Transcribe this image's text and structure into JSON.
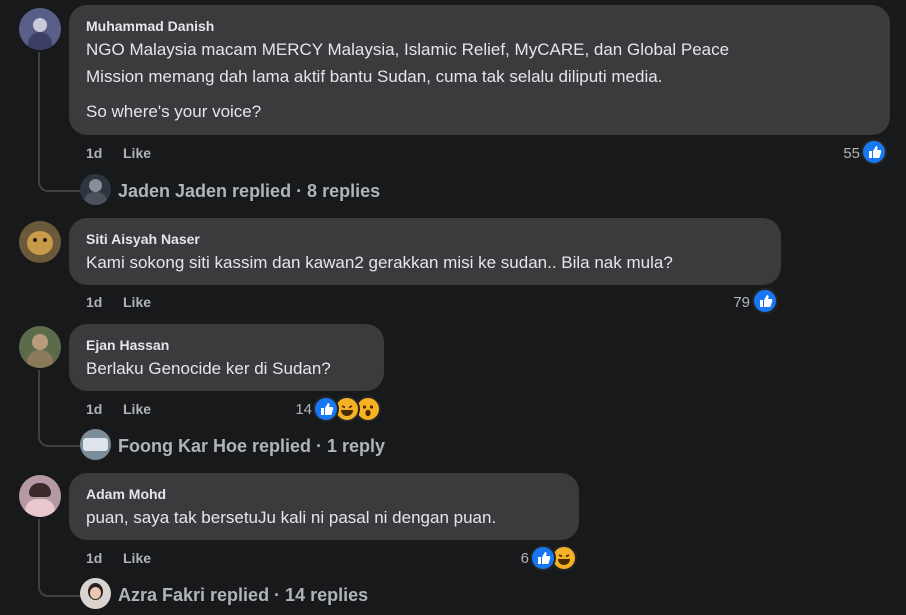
{
  "comments": [
    {
      "author": "Muhammad Danish",
      "lines": [
        "NGO Malaysia macam MERCY Malaysia, Islamic Relief, MyCARE, dan Global Peace",
        "Mission memang dah lama aktif bantu Sudan, cuma tak selalu diliputi media."
      ],
      "extra_line": "So where's your voice?",
      "age": "1d",
      "like_label": "Like",
      "reaction_count": "55",
      "replies": "Jaden Jaden replied · 8 replies"
    },
    {
      "author": "Siti Aisyah Naser",
      "lines": [
        "Kami sokong siti kassim dan kawan2 gerakkan misi ke sudan.. Bila nak mula?"
      ],
      "age": "1d",
      "like_label": "Like",
      "reaction_count": "79"
    },
    {
      "author": "Ejan Hassan",
      "lines": [
        "Berlaku Genocide ker di Sudan?"
      ],
      "age": "1d",
      "like_label": "Like",
      "reaction_count": "14",
      "replies": "Foong Kar Hoe replied · 1 reply"
    },
    {
      "author": "Adam Mohd",
      "lines": [
        "puan, saya tak bersetuJu kali ni pasal ni dengan puan."
      ],
      "age": "1d",
      "like_label": "Like",
      "reaction_count": "6",
      "replies": "Azra Fakri replied · 14 replies"
    }
  ],
  "colors": {
    "background": "#18191a",
    "bubble": "#3a3b3c",
    "like_blue": "#1877f2",
    "emoji_yellow": "#f7b125"
  },
  "icons": [
    "like-reaction-icon",
    "haha-reaction-icon",
    "wow-reaction-icon"
  ]
}
